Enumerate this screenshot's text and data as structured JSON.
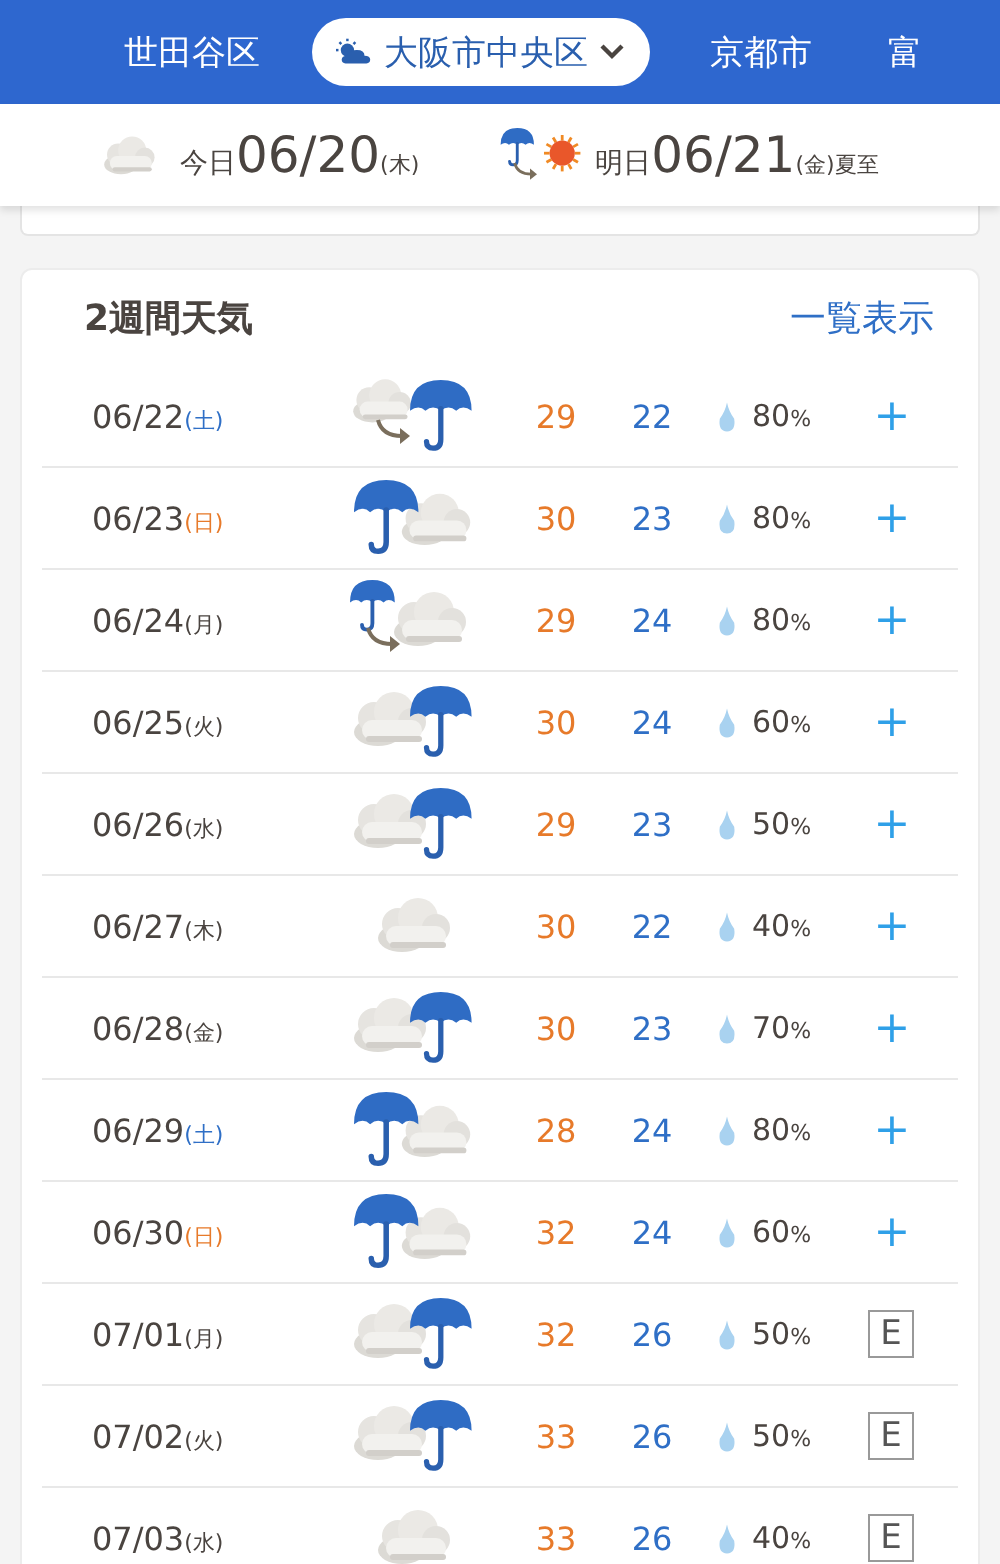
{
  "nav": {
    "tabs": [
      {
        "label": "世田谷区",
        "selected": false
      },
      {
        "label": "大阪市中央区",
        "selected": true
      },
      {
        "label": "京都市",
        "selected": false
      },
      {
        "label": "富",
        "selected": false
      }
    ]
  },
  "summary": [
    {
      "weather": {
        "kind": "cloud"
      },
      "label": "今日",
      "date": "06/20",
      "weekday": "(木)"
    },
    {
      "weather": {
        "kind": "rain_to_sun"
      },
      "label": "明日",
      "date": "06/21",
      "weekday": "(金)",
      "note": "夏至"
    }
  ],
  "forecast": {
    "title": "2週間天気",
    "link": "一覧表示",
    "rows": [
      {
        "date": "06/22",
        "weekday": {
          "text": "(土)",
          "kind": "sat"
        },
        "weather": {
          "kind": "cloud_to_rain"
        },
        "high": "29",
        "low": "22",
        "precip": "80",
        "unit": "%",
        "action": {
          "text": "+",
          "kind": "plus"
        }
      },
      {
        "date": "06/23",
        "weekday": {
          "text": "(日)",
          "kind": "sun"
        },
        "weather": {
          "kind": "rain_cloud"
        },
        "high": "30",
        "low": "23",
        "precip": "80",
        "unit": "%",
        "action": {
          "text": "+",
          "kind": "plus"
        }
      },
      {
        "date": "06/24",
        "weekday": {
          "text": "(月)",
          "kind": "weekday"
        },
        "weather": {
          "kind": "rain_to_cloud"
        },
        "high": "29",
        "low": "24",
        "precip": "80",
        "unit": "%",
        "action": {
          "text": "+",
          "kind": "plus"
        }
      },
      {
        "date": "06/25",
        "weekday": {
          "text": "(火)",
          "kind": "weekday"
        },
        "weather": {
          "kind": "cloud_rain"
        },
        "high": "30",
        "low": "24",
        "precip": "60",
        "unit": "%",
        "action": {
          "text": "+",
          "kind": "plus"
        }
      },
      {
        "date": "06/26",
        "weekday": {
          "text": "(水)",
          "kind": "weekday"
        },
        "weather": {
          "kind": "cloud_rain"
        },
        "high": "29",
        "low": "23",
        "precip": "50",
        "unit": "%",
        "action": {
          "text": "+",
          "kind": "plus"
        }
      },
      {
        "date": "06/27",
        "weekday": {
          "text": "(木)",
          "kind": "weekday"
        },
        "weather": {
          "kind": "cloud"
        },
        "high": "30",
        "low": "22",
        "precip": "40",
        "unit": "%",
        "action": {
          "text": "+",
          "kind": "plus"
        }
      },
      {
        "date": "06/28",
        "weekday": {
          "text": "(金)",
          "kind": "weekday"
        },
        "weather": {
          "kind": "cloud_rain"
        },
        "high": "30",
        "low": "23",
        "precip": "70",
        "unit": "%",
        "action": {
          "text": "+",
          "kind": "plus"
        }
      },
      {
        "date": "06/29",
        "weekday": {
          "text": "(土)",
          "kind": "sat"
        },
        "weather": {
          "kind": "rain_cloud"
        },
        "high": "28",
        "low": "24",
        "precip": "80",
        "unit": "%",
        "action": {
          "text": "+",
          "kind": "plus"
        }
      },
      {
        "date": "06/30",
        "weekday": {
          "text": "(日)",
          "kind": "sun"
        },
        "weather": {
          "kind": "rain_cloud"
        },
        "high": "32",
        "low": "24",
        "precip": "60",
        "unit": "%",
        "action": {
          "text": "+",
          "kind": "plus"
        }
      },
      {
        "date": "07/01",
        "weekday": {
          "text": "(月)",
          "kind": "weekday"
        },
        "weather": {
          "kind": "cloud_rain"
        },
        "high": "32",
        "low": "26",
        "precip": "50",
        "unit": "%",
        "action": {
          "text": "E",
          "kind": "grade"
        }
      },
      {
        "date": "07/02",
        "weekday": {
          "text": "(火)",
          "kind": "weekday"
        },
        "weather": {
          "kind": "cloud_rain"
        },
        "high": "33",
        "low": "26",
        "precip": "50",
        "unit": "%",
        "action": {
          "text": "E",
          "kind": "grade"
        }
      },
      {
        "date": "07/03",
        "weekday": {
          "text": "(水)",
          "kind": "weekday"
        },
        "weather": {
          "kind": "cloud"
        },
        "high": "33",
        "low": "26",
        "precip": "40",
        "unit": "%",
        "action": {
          "text": "E",
          "kind": "grade"
        }
      }
    ]
  }
}
